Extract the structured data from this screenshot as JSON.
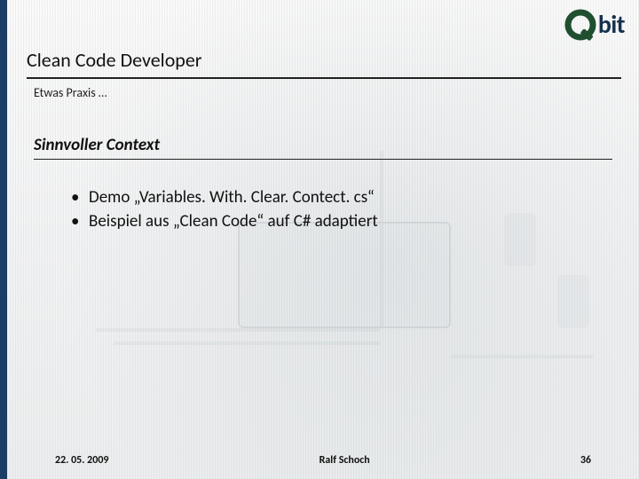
{
  "logo": {
    "text": "bit"
  },
  "title": "Clean Code Developer",
  "subtitle": "Etwas Praxis …",
  "section_heading": "Sinnvoller Context",
  "bullets": [
    "Demo „Variables. With. Clear. Contect. cs“",
    "Beispiel aus „Clean Code“ auf C# adaptiert"
  ],
  "footer": {
    "date": "22. 05. 2009",
    "author": "Ralf Schoch",
    "page": "36"
  }
}
